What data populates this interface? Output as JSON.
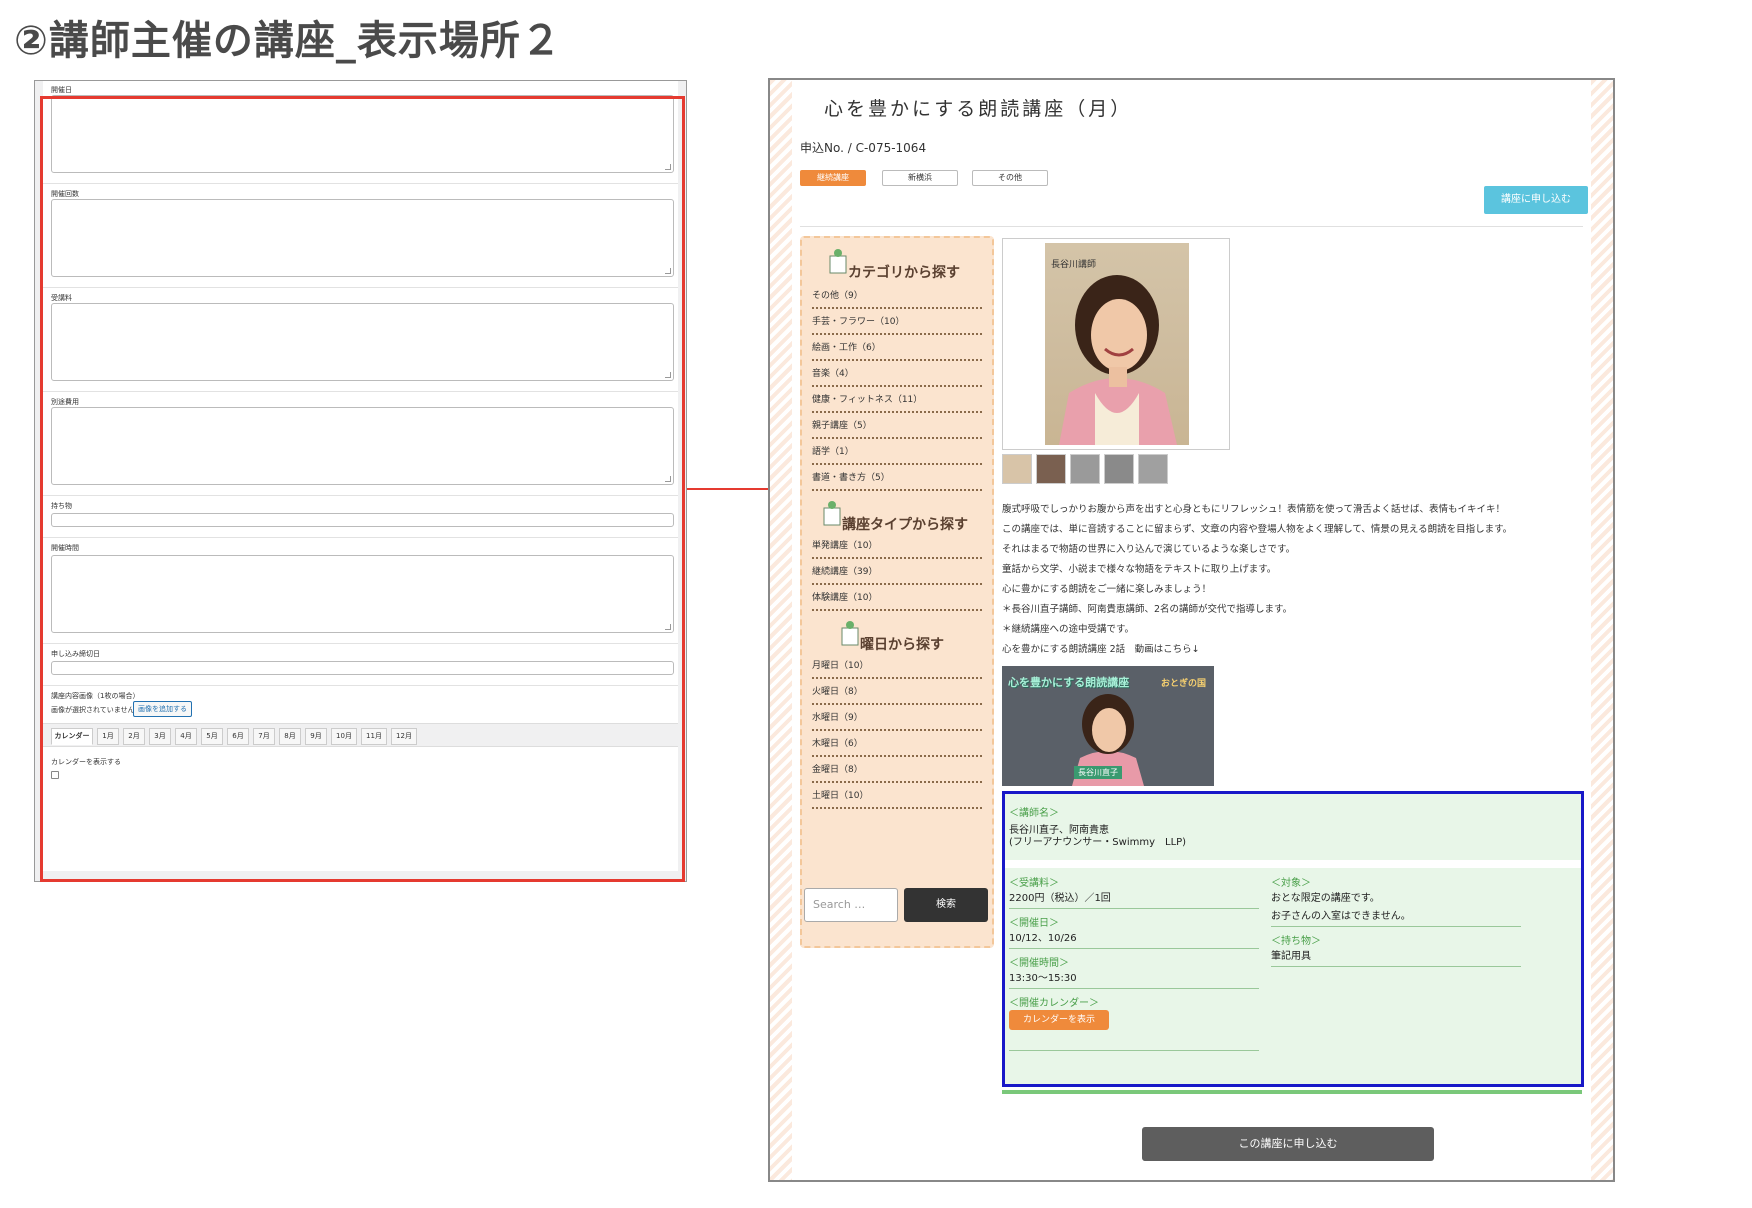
{
  "slide": {
    "title": "②講師主催の講座_表示場所２"
  },
  "admin": {
    "fields": [
      {
        "label": "開催日"
      },
      {
        "label": "開催回数"
      },
      {
        "label": "受講料"
      },
      {
        "label": "別途費用"
      },
      {
        "label": "持ち物"
      },
      {
        "label": "開催時間"
      },
      {
        "label": "申し込み締切日"
      }
    ],
    "image_label": "講座内容画像（1枚の場合）",
    "image_none": "画像が選択されていません",
    "image_add_button": "画像を追加する",
    "tabs": [
      "カレンダー",
      "1月",
      "2月",
      "3月",
      "4月",
      "5月",
      "6月",
      "7月",
      "8月",
      "9月",
      "10月",
      "11月",
      "12月"
    ],
    "calendar_checkbox_label": "カレンダーを表示する"
  },
  "site": {
    "title": "心を豊かにする朗読講座（月）",
    "application_no": "申込No. / C-075-1064",
    "tags": [
      "継続講座",
      "新横浜",
      "その他"
    ],
    "apply_top": "講座に申し込む",
    "sidebar": {
      "category_head": "カテゴリから探す",
      "categories": [
        "その他（9）",
        "手芸・フラワー（10）",
        "絵画・工作（6）",
        "音楽（4）",
        "健康・フィットネス（11）",
        "親子講座（5）",
        "語学（1）",
        "書道・書き方（5）"
      ],
      "type_head": "講座タイプから探す",
      "types": [
        "単発講座（10）",
        "継続講座（39）",
        "体験講座（10）"
      ],
      "day_head": "曜日から探す",
      "days": [
        "月曜日（10）",
        "火曜日（8）",
        "水曜日（9）",
        "木曜日（6）",
        "金曜日（8）",
        "土曜日（10）"
      ],
      "search_placeholder": "Search …",
      "search_button": "検索"
    },
    "photo_label": "長谷川講師",
    "description": [
      "腹式呼吸でしっかりお腹から声を出すと心身ともにリフレッシュ！表情筋を使って滑舌よく話せば、表情もイキイキ！",
      "この講座では、単に音読することに留まらず、文章の内容や登場人物をよく理解して、情景の見える朗読を目指します。",
      "それはまるで物語の世界に入り込んで演じているような楽しさです。",
      "童話から文学、小説まで様々な物語をテキストに取り上げます。",
      "心に豊かにする朗読をご一緒に楽しみましょう！",
      "＊長谷川直子講師、阿南貴恵講師、2名の講師が交代で指導します。",
      "＊継続講座への途中受講です。",
      "心を豊かにする朗読講座 2話　動画はこちら↓"
    ],
    "video": {
      "title": "心を豊かにする朗読講座",
      "subtitle": "おとぎの国",
      "name": "長谷川直子"
    },
    "info": {
      "instructor_label": "＜講師名＞",
      "instructor_value1": "長谷川直子、阿南貴恵",
      "instructor_value2": "(フリーアナウンサー・Swimmy　LLP)",
      "fee_label": "＜受講料＞",
      "fee_value": "2200円（税込）／1回",
      "date_label": "＜開催日＞",
      "date_value": "10/12、10/26",
      "time_label": "＜開催時間＞",
      "time_value": "13:30〜15:30",
      "calendar_label": "＜開催カレンダー＞",
      "calendar_button": "カレンダーを表示",
      "target_label": "＜対象＞",
      "target_value1": "おとな限定の講座です。",
      "target_value2": "お子さんの入室はできません。",
      "items_label": "＜持ち物＞",
      "items_value": "筆記用具"
    },
    "apply_bottom": "この講座に申し込む"
  },
  "colors": {
    "highlight_red": "#e53a30",
    "highlight_blue": "#1818c8",
    "accent_orange": "#ef8a3b",
    "apply_blue": "#5bc4de"
  }
}
